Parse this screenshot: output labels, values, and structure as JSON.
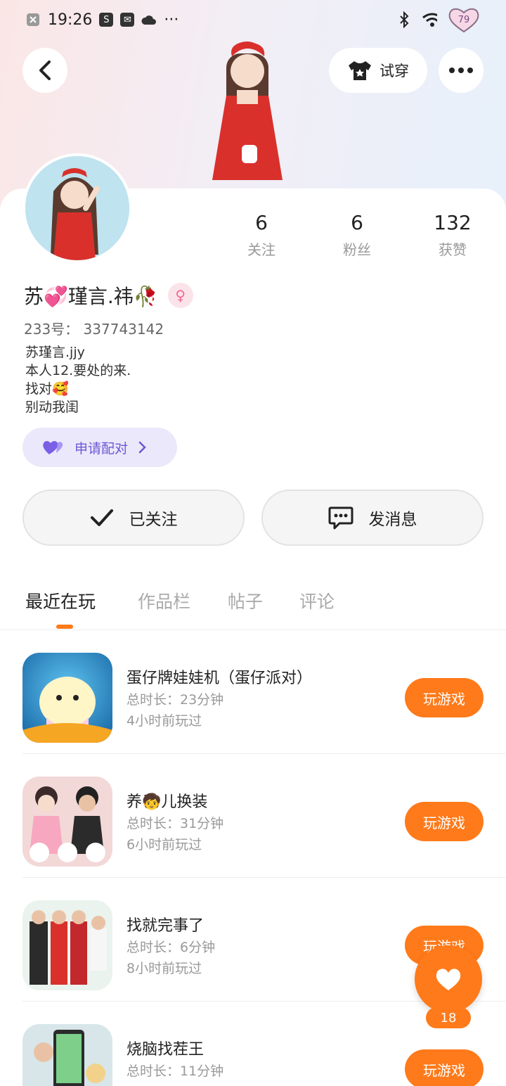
{
  "status_bar": {
    "time": "19:26",
    "battery": "79"
  },
  "header": {
    "try_on_label": "试穿"
  },
  "profile": {
    "nickname": "苏💞瑾言.祎🥀",
    "uid_label": "233号：",
    "uid": "337743142",
    "bio": [
      "苏瑾言.jjy",
      "本人12.要处的来.",
      "找对🥰",
      "别动我闺"
    ],
    "pair_label": "申请配对"
  },
  "stats": [
    {
      "value": "6",
      "label": "关注"
    },
    {
      "value": "6",
      "label": "粉丝"
    },
    {
      "value": "132",
      "label": "获赞"
    }
  ],
  "actions": {
    "follow_label": "已关注",
    "message_label": "发消息"
  },
  "tabs": [
    "最近在玩",
    "作品栏",
    "帖子",
    "评论"
  ],
  "games": [
    {
      "title": "蛋仔牌娃娃机（蛋仔派对）",
      "duration": "总时长：23分钟",
      "last_played": "4小时前玩过",
      "button": "玩游戏"
    },
    {
      "title": "养🧒儿换装",
      "duration": "总时长：31分钟",
      "last_played": "6小时前玩过",
      "button": "玩游戏"
    },
    {
      "title": "找就完事了",
      "duration": "总时长：6分钟",
      "last_played": "8小时前玩过",
      "button": "玩游戏"
    },
    {
      "title": "烧脑找茬王",
      "duration": "总时长：11分钟",
      "last_played": "",
      "button": "玩游戏"
    }
  ],
  "float_like": {
    "count": "18"
  },
  "colors": {
    "accent": "#ff7a1a",
    "pair_bg": "#ebe8fb",
    "pair_text": "#6b58d6"
  }
}
